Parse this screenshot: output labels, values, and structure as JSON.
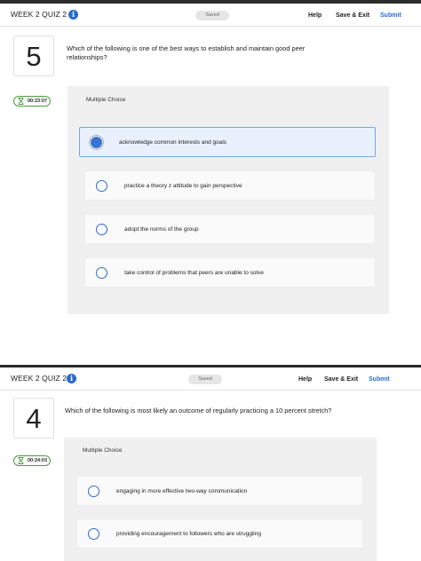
{
  "screens": [
    {
      "quiz_title": "WEEK 2 QUIZ 2",
      "saved": "Saved",
      "help": "Help",
      "save_exit": "Save & Exit",
      "submit": "Submit",
      "question_number": "5",
      "question_line1": "Which of the following is one of the best ways to establish and maintain good peer",
      "question_line2": "relationships?",
      "timer": "00:23:07",
      "choice_type": "Multiple Choice",
      "options": [
        {
          "text": "acknowledge common interests and goals",
          "selected": true
        },
        {
          "text": "practice a theory z attitude to gain perspective",
          "selected": false
        },
        {
          "text": "adopt the norms of the group",
          "selected": false
        },
        {
          "text": "take control of problems that peers are unable to solve",
          "selected": false
        }
      ]
    },
    {
      "quiz_title": "WEEK 2 QUIZ 2",
      "saved": "Saved",
      "help": "Help",
      "save_exit": "Save & Exit",
      "submit": "Submit",
      "question_number": "4",
      "question_line1": "Which of the following is most likely an outcome of regularly practicing a 10 percent stretch?",
      "timer": "00:24:03",
      "choice_type": "Multiple Choice",
      "options": [
        {
          "text": "engaging in more effective two-way communication",
          "selected": false
        },
        {
          "text": "providing encouragement to followers who are struggling",
          "selected": false
        }
      ]
    }
  ],
  "colors": {
    "accent": "#2a6ad0",
    "timer_border": "#4a9d3c",
    "panel_bg": "#f0f0f0",
    "selected_bg": "#e9f1fc"
  },
  "icons": {
    "info": "info-icon",
    "timer": "hourglass-icon",
    "radio": "radio-button-icon"
  }
}
